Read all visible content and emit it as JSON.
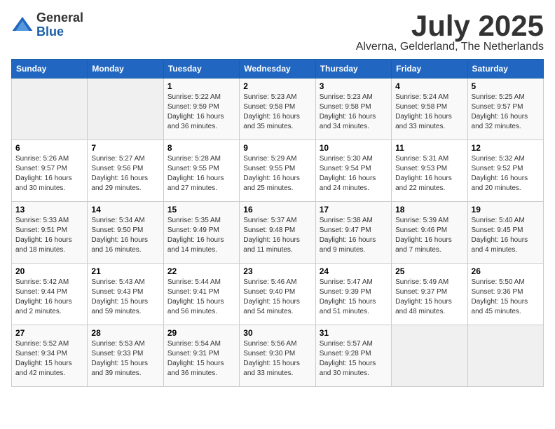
{
  "logo": {
    "general": "General",
    "blue": "Blue"
  },
  "title": "July 2025",
  "location": "Alverna, Gelderland, The Netherlands",
  "days_of_week": [
    "Sunday",
    "Monday",
    "Tuesday",
    "Wednesday",
    "Thursday",
    "Friday",
    "Saturday"
  ],
  "weeks": [
    [
      {
        "day": "",
        "content": ""
      },
      {
        "day": "",
        "content": ""
      },
      {
        "day": "1",
        "content": "Sunrise: 5:22 AM\nSunset: 9:59 PM\nDaylight: 16 hours\nand 36 minutes."
      },
      {
        "day": "2",
        "content": "Sunrise: 5:23 AM\nSunset: 9:58 PM\nDaylight: 16 hours\nand 35 minutes."
      },
      {
        "day": "3",
        "content": "Sunrise: 5:23 AM\nSunset: 9:58 PM\nDaylight: 16 hours\nand 34 minutes."
      },
      {
        "day": "4",
        "content": "Sunrise: 5:24 AM\nSunset: 9:58 PM\nDaylight: 16 hours\nand 33 minutes."
      },
      {
        "day": "5",
        "content": "Sunrise: 5:25 AM\nSunset: 9:57 PM\nDaylight: 16 hours\nand 32 minutes."
      }
    ],
    [
      {
        "day": "6",
        "content": "Sunrise: 5:26 AM\nSunset: 9:57 PM\nDaylight: 16 hours\nand 30 minutes."
      },
      {
        "day": "7",
        "content": "Sunrise: 5:27 AM\nSunset: 9:56 PM\nDaylight: 16 hours\nand 29 minutes."
      },
      {
        "day": "8",
        "content": "Sunrise: 5:28 AM\nSunset: 9:55 PM\nDaylight: 16 hours\nand 27 minutes."
      },
      {
        "day": "9",
        "content": "Sunrise: 5:29 AM\nSunset: 9:55 PM\nDaylight: 16 hours\nand 25 minutes."
      },
      {
        "day": "10",
        "content": "Sunrise: 5:30 AM\nSunset: 9:54 PM\nDaylight: 16 hours\nand 24 minutes."
      },
      {
        "day": "11",
        "content": "Sunrise: 5:31 AM\nSunset: 9:53 PM\nDaylight: 16 hours\nand 22 minutes."
      },
      {
        "day": "12",
        "content": "Sunrise: 5:32 AM\nSunset: 9:52 PM\nDaylight: 16 hours\nand 20 minutes."
      }
    ],
    [
      {
        "day": "13",
        "content": "Sunrise: 5:33 AM\nSunset: 9:51 PM\nDaylight: 16 hours\nand 18 minutes."
      },
      {
        "day": "14",
        "content": "Sunrise: 5:34 AM\nSunset: 9:50 PM\nDaylight: 16 hours\nand 16 minutes."
      },
      {
        "day": "15",
        "content": "Sunrise: 5:35 AM\nSunset: 9:49 PM\nDaylight: 16 hours\nand 14 minutes."
      },
      {
        "day": "16",
        "content": "Sunrise: 5:37 AM\nSunset: 9:48 PM\nDaylight: 16 hours\nand 11 minutes."
      },
      {
        "day": "17",
        "content": "Sunrise: 5:38 AM\nSunset: 9:47 PM\nDaylight: 16 hours\nand 9 minutes."
      },
      {
        "day": "18",
        "content": "Sunrise: 5:39 AM\nSunset: 9:46 PM\nDaylight: 16 hours\nand 7 minutes."
      },
      {
        "day": "19",
        "content": "Sunrise: 5:40 AM\nSunset: 9:45 PM\nDaylight: 16 hours\nand 4 minutes."
      }
    ],
    [
      {
        "day": "20",
        "content": "Sunrise: 5:42 AM\nSunset: 9:44 PM\nDaylight: 16 hours\nand 2 minutes."
      },
      {
        "day": "21",
        "content": "Sunrise: 5:43 AM\nSunset: 9:43 PM\nDaylight: 15 hours\nand 59 minutes."
      },
      {
        "day": "22",
        "content": "Sunrise: 5:44 AM\nSunset: 9:41 PM\nDaylight: 15 hours\nand 56 minutes."
      },
      {
        "day": "23",
        "content": "Sunrise: 5:46 AM\nSunset: 9:40 PM\nDaylight: 15 hours\nand 54 minutes."
      },
      {
        "day": "24",
        "content": "Sunrise: 5:47 AM\nSunset: 9:39 PM\nDaylight: 15 hours\nand 51 minutes."
      },
      {
        "day": "25",
        "content": "Sunrise: 5:49 AM\nSunset: 9:37 PM\nDaylight: 15 hours\nand 48 minutes."
      },
      {
        "day": "26",
        "content": "Sunrise: 5:50 AM\nSunset: 9:36 PM\nDaylight: 15 hours\nand 45 minutes."
      }
    ],
    [
      {
        "day": "27",
        "content": "Sunrise: 5:52 AM\nSunset: 9:34 PM\nDaylight: 15 hours\nand 42 minutes."
      },
      {
        "day": "28",
        "content": "Sunrise: 5:53 AM\nSunset: 9:33 PM\nDaylight: 15 hours\nand 39 minutes."
      },
      {
        "day": "29",
        "content": "Sunrise: 5:54 AM\nSunset: 9:31 PM\nDaylight: 15 hours\nand 36 minutes."
      },
      {
        "day": "30",
        "content": "Sunrise: 5:56 AM\nSunset: 9:30 PM\nDaylight: 15 hours\nand 33 minutes."
      },
      {
        "day": "31",
        "content": "Sunrise: 5:57 AM\nSunset: 9:28 PM\nDaylight: 15 hours\nand 30 minutes."
      },
      {
        "day": "",
        "content": ""
      },
      {
        "day": "",
        "content": ""
      }
    ]
  ]
}
